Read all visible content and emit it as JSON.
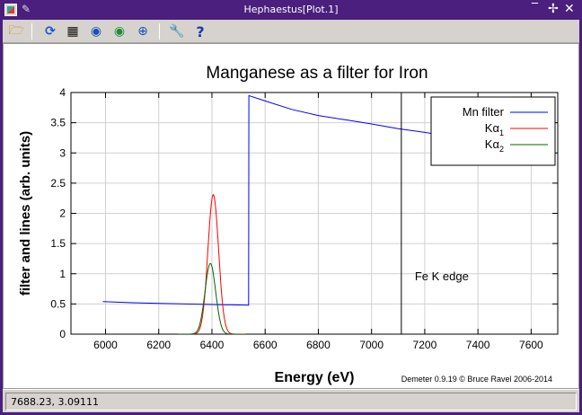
{
  "window": {
    "title": "Hephaestus[Plot.1]",
    "icons": [
      "app-icon",
      "pin-icon",
      "minimize-icon",
      "maximize-icon",
      "close-icon"
    ]
  },
  "toolbar": {
    "buttons": [
      {
        "name": "open-icon",
        "glyph": "📂"
      },
      {
        "name": "refresh-icon",
        "glyph": "⟳"
      },
      {
        "name": "grid-icon",
        "glyph": "▦"
      },
      {
        "name": "zoom-back-icon",
        "glyph": "◀"
      },
      {
        "name": "zoom-forward-icon",
        "glyph": "▶"
      },
      {
        "name": "zoom-icon",
        "glyph": "⌕"
      },
      {
        "name": "settings-icon",
        "glyph": "🔧"
      },
      {
        "name": "help-icon",
        "glyph": "?"
      }
    ]
  },
  "status": {
    "coords": "7688.23,  3.09111"
  },
  "chart_data": {
    "type": "line",
    "title": "Manganese as a filter for Iron",
    "xlabel": "Energy (eV)",
    "ylabel": "filter and lines (arb. units)",
    "xlim": [
      5870,
      7700
    ],
    "ylim": [
      0,
      4
    ],
    "xticks": [
      6000,
      6200,
      6400,
      6600,
      6800,
      7000,
      7200,
      7400,
      7600
    ],
    "yticks": [
      0,
      0.5,
      1,
      1.5,
      2,
      2.5,
      3,
      3.5,
      4
    ],
    "ytick_labels": [
      "0",
      "0.5",
      "1",
      "1.5",
      "2",
      "2.5",
      "3",
      "3.5",
      "4"
    ],
    "grid": true,
    "legend_position": "top-right",
    "series": [
      {
        "name": "Mn filter",
        "color": "#0000ff",
        "x": [
          5990,
          6100,
          6200,
          6300,
          6400,
          6538,
          6539,
          6600,
          6700,
          6800,
          6900,
          7000,
          7100,
          7200,
          7300,
          7400
        ],
        "y": [
          0.54,
          0.52,
          0.51,
          0.5,
          0.49,
          0.48,
          3.95,
          3.86,
          3.72,
          3.62,
          3.55,
          3.48,
          3.4,
          3.34,
          3.27,
          3.2
        ]
      },
      {
        "name": "Kα1",
        "name_main": "Kα",
        "name_sub": "1",
        "color": "#ff0000",
        "peak_center": 6405,
        "peak_height": 2.31,
        "peak_sigma": 20
      },
      {
        "name": "Kα2",
        "name_main": "Kα",
        "name_sub": "2",
        "color": "#006600",
        "peak_center": 6394,
        "peak_height": 1.17,
        "peak_sigma": 20
      }
    ],
    "vline": {
      "x": 7112,
      "label": "Fe K edge",
      "label_y": 0.95
    },
    "credit": "Demeter 0.9.19 © Bruce Ravel 2006-2014"
  }
}
